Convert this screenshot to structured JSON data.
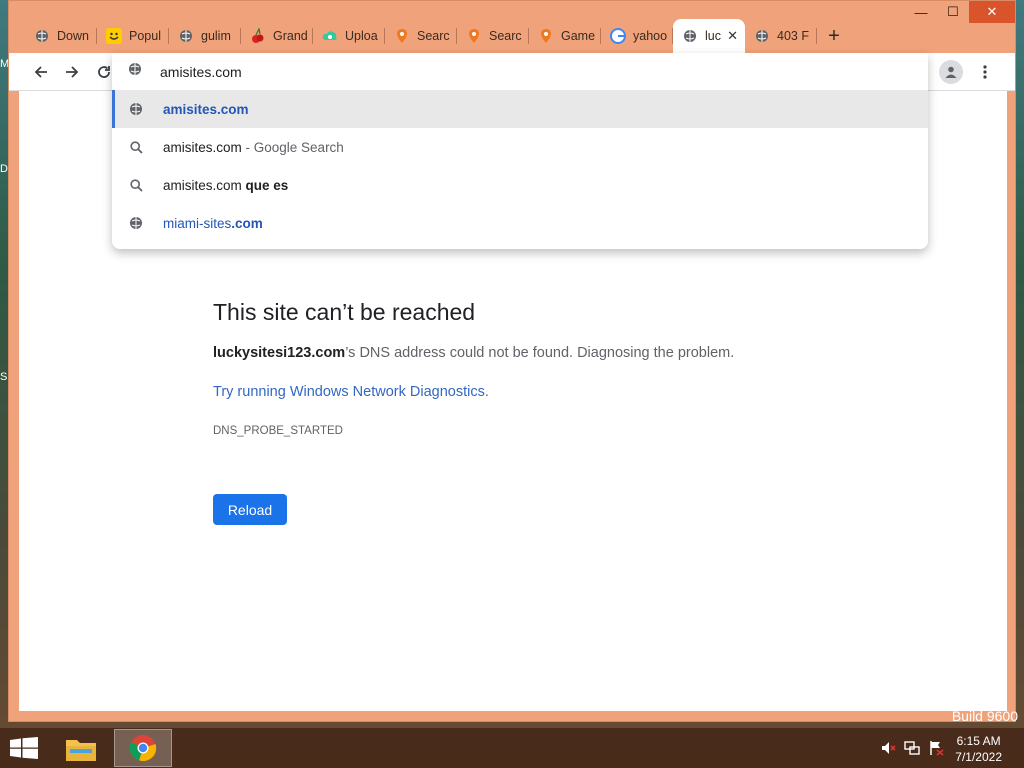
{
  "desktop": {
    "edge_letters": [
      "M",
      "D",
      "S"
    ],
    "build_text": "Build 9600"
  },
  "tabs": [
    {
      "title": "Down",
      "icon": "globe-icon"
    },
    {
      "title": "Popul",
      "icon": "smiley-icon"
    },
    {
      "title": "gulim",
      "icon": "globe-icon"
    },
    {
      "title": "Grand",
      "icon": "cherry-icon"
    },
    {
      "title": "Uploa",
      "icon": "upload-cloud-icon"
    },
    {
      "title": "Searc",
      "icon": "location-icon"
    },
    {
      "title": "Searc",
      "icon": "location-icon"
    },
    {
      "title": "Game",
      "icon": "location-icon"
    },
    {
      "title": "yahoo",
      "icon": "google-icon"
    },
    {
      "title": "luc",
      "icon": "globe-icon",
      "active": true
    },
    {
      "title": "403 F",
      "icon": "globe-icon"
    }
  ],
  "window_controls": {
    "minimize": "—",
    "maximize": "☐",
    "close": "✕"
  },
  "omnibox": {
    "typed_text": "amisites.com",
    "suggestions": [
      {
        "icon": "globe-icon",
        "text": "amisites.com",
        "style": "url-bold"
      },
      {
        "icon": "search-icon",
        "text": "amisites.com",
        "suffix": " - Google Search"
      },
      {
        "icon": "search-icon",
        "text": "amisites.com ",
        "bold_suffix": "que es"
      },
      {
        "icon": "globe-icon",
        "text": "miami-sites",
        "bold_suffix": ".com",
        "style": "url"
      }
    ]
  },
  "error_page": {
    "title": "This site can’t be reached",
    "host": "luckysitesi123.com",
    "description": "’s DNS address could not be found. Diagnosing the problem.",
    "link": "Try running Windows Network Diagnostics",
    "link_period": ".",
    "code": "DNS_PROBE_STARTED",
    "reload_label": "Reload"
  },
  "taskbar": {
    "time": "6:15 AM",
    "date": "7/1/2022"
  },
  "colors": {
    "frame": "#f0a27a",
    "accent_blue": "#1a73e8",
    "link_blue": "#3367c4"
  }
}
